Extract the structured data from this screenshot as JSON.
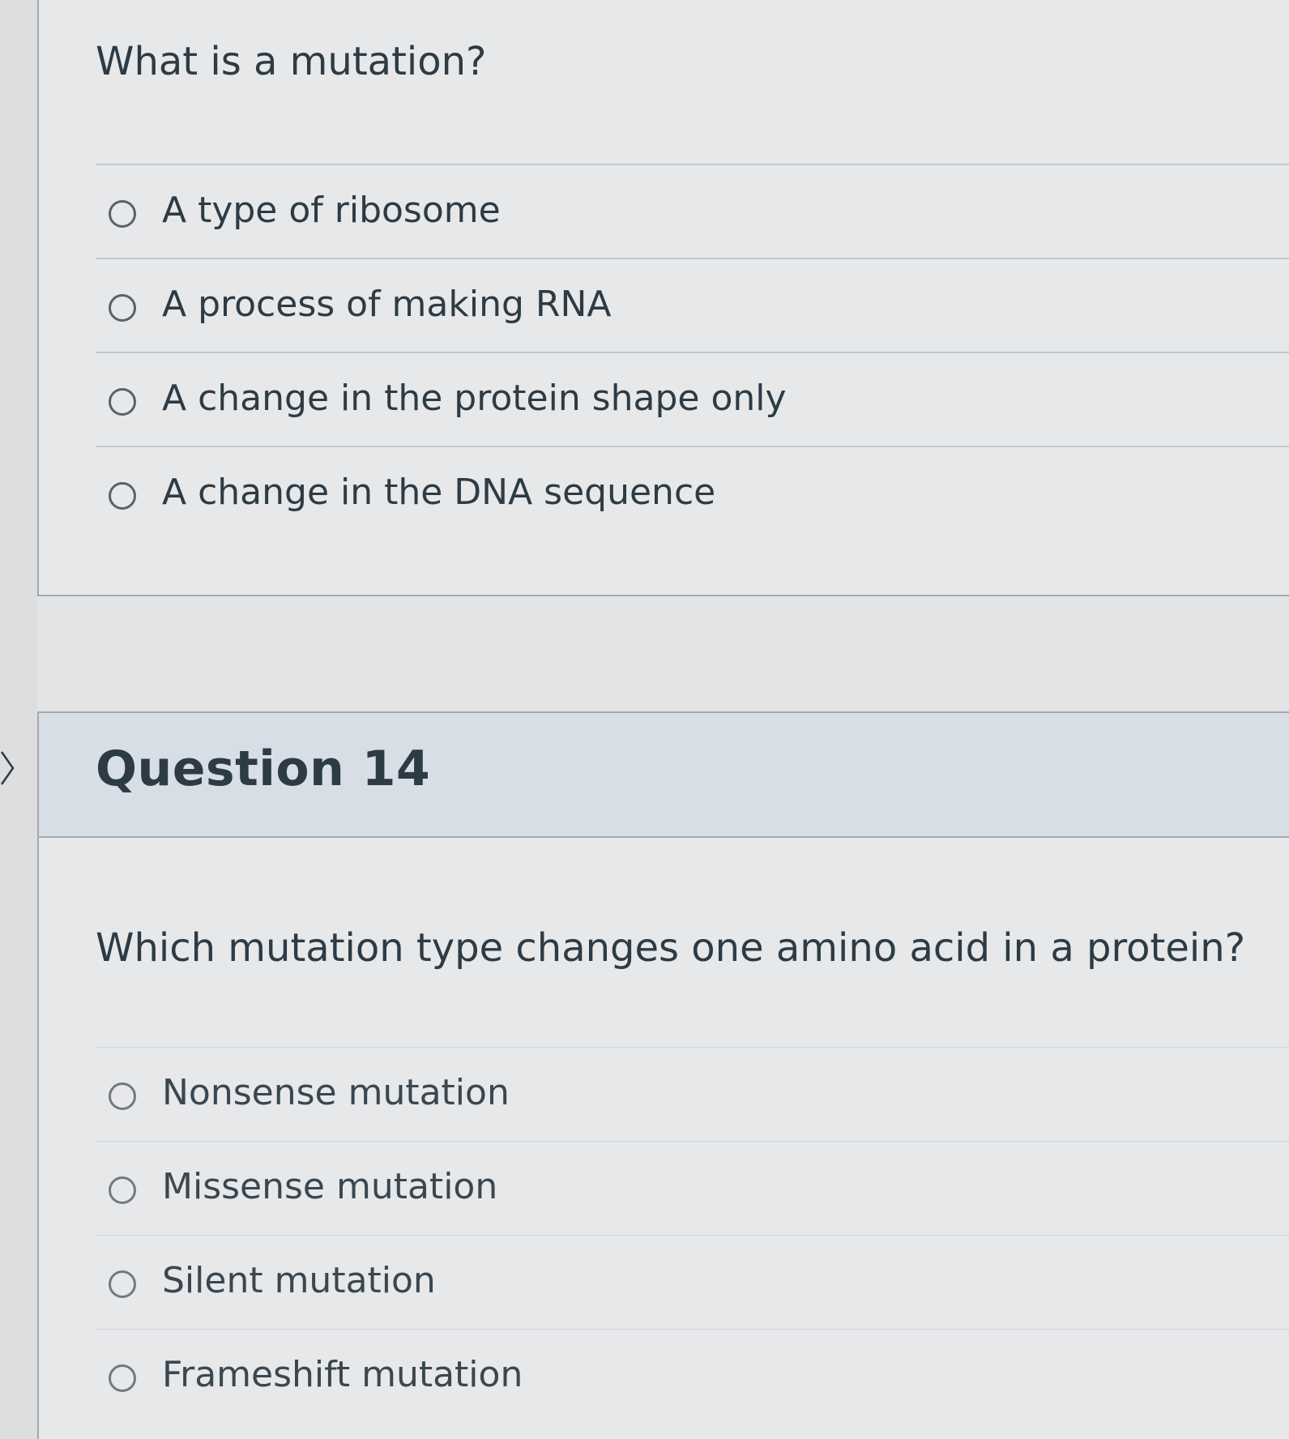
{
  "question13": {
    "text": "What is a mutation?",
    "answers": [
      {
        "label": "A type of ribosome"
      },
      {
        "label": "A process of making RNA"
      },
      {
        "label": "A change in the protein shape only"
      },
      {
        "label": "A change in the DNA sequence"
      }
    ]
  },
  "question14": {
    "title": "Question 14",
    "text": "Which mutation type changes one amino acid in a protein?",
    "answers": [
      {
        "label": "Nonsense mutation"
      },
      {
        "label": "Missense mutation"
      },
      {
        "label": "Silent mutation"
      },
      {
        "label": "Frameshift mutation"
      }
    ]
  },
  "nav": {
    "arrow_icon": "chevron-right-icon"
  }
}
